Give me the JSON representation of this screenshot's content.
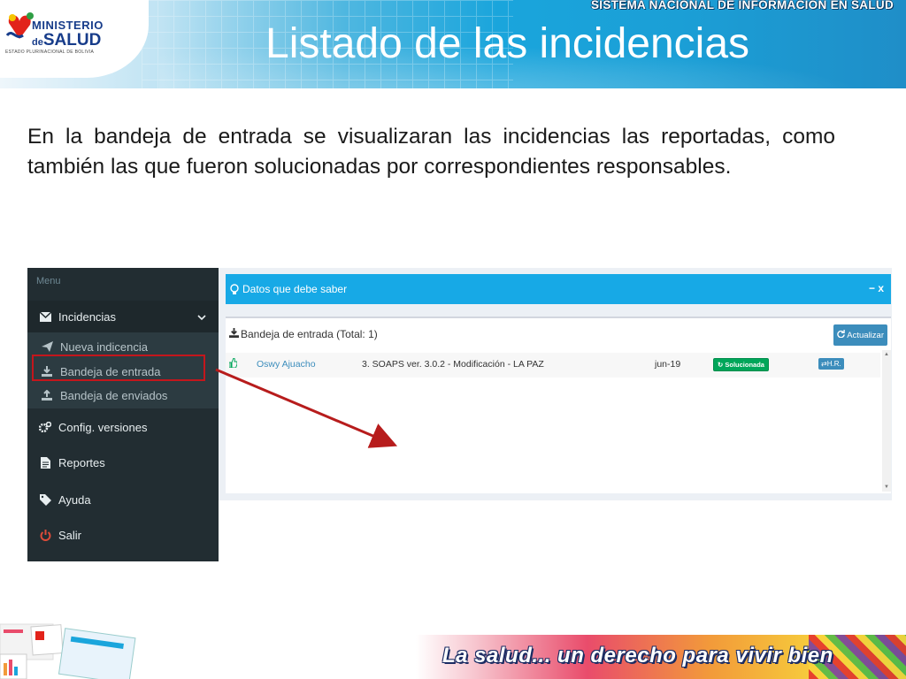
{
  "header": {
    "logo_line1": "MINISTERIO",
    "logo_line2_prefix": "de",
    "logo_line2": "SALUD",
    "logo_sub": "ESTADO PLURINACIONAL DE BOLIVIA",
    "system_name": "SISTEMA NACIONAL DE INFORMACION EN SALUD",
    "title": "Listado de las incidencias"
  },
  "description": "En la bandeja de entrada se visualizaran las incidencias las reportadas, como también las que fueron solucionadas por correspondientes responsables.",
  "sidebar": {
    "header": "Menu",
    "items": [
      {
        "label": "Incidencias",
        "icon": "envelope-icon"
      },
      {
        "label": "Config. versiones",
        "icon": "cogs-icon"
      },
      {
        "label": "Reportes",
        "icon": "file-icon"
      },
      {
        "label": "Ayuda",
        "icon": "tag-icon"
      },
      {
        "label": "Salir",
        "icon": "power-icon"
      }
    ],
    "subitems": [
      {
        "label": "Nueva indicencia",
        "icon": "paper-plane-icon"
      },
      {
        "label": "Bandeja de entrada",
        "icon": "download-icon"
      },
      {
        "label": "Bandeja de enviados",
        "icon": "upload-icon"
      }
    ]
  },
  "info_bar": {
    "title": "Datos que debe saber",
    "controls": "− x"
  },
  "inbox": {
    "title": "Bandeja de entrada (Total: 1)",
    "refresh_label": "Actualizar",
    "rows": [
      {
        "user": "Oswy Ajuacho",
        "subject": "3. SOAPS ver. 3.0.2 - Modificación - LA PAZ",
        "date": "jun-19",
        "status": "Solucionada",
        "action": "H.R."
      }
    ]
  },
  "footer": {
    "slogan": "La salud... un derecho para vivir bien"
  },
  "colors": {
    "sidebar_bg": "#222d32",
    "info_bar": "#17a9e6",
    "status_green": "#00a65a",
    "button_blue": "#3c8dbc",
    "highlight_red": "#c4161c"
  }
}
